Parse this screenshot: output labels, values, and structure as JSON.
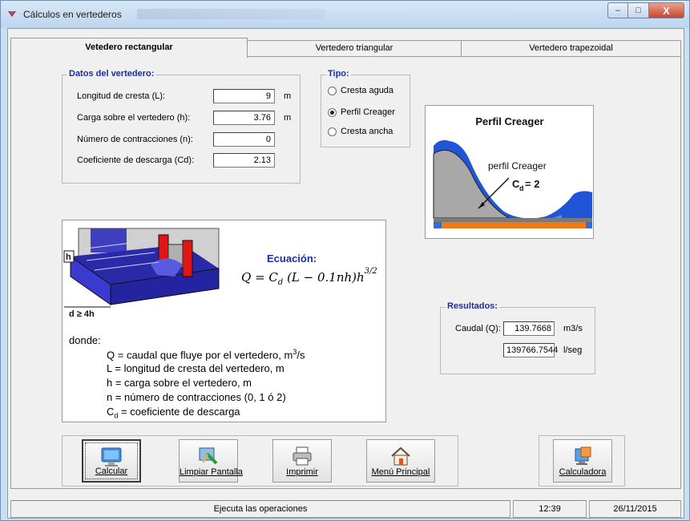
{
  "window": {
    "title": "Cálculos en vertederos",
    "title_blurred": "",
    "controls": {
      "minimize": "–",
      "maximize": "□",
      "close": "X"
    }
  },
  "tabs": [
    {
      "label": "Vetedero rectangular",
      "active": true
    },
    {
      "label": "Vertedero triangular",
      "active": false
    },
    {
      "label": "Vertedero trapezoidal",
      "active": false
    }
  ],
  "datos": {
    "legend": "Datos del vertedero:",
    "fields": [
      {
        "label": "Longitud de cresta (L):",
        "value": "9",
        "unit": "m"
      },
      {
        "label": "Carga sobre el vertedero (h):",
        "value": "3.76",
        "unit": "m"
      },
      {
        "label": "Número de contracciones (n):",
        "value": "0",
        "unit": ""
      },
      {
        "label": "Coeficiente de descarga (Cd):",
        "value": "2.13",
        "unit": ""
      }
    ]
  },
  "tipo": {
    "legend": "Tipo:",
    "options": [
      {
        "label": "Cresta aguda",
        "selected": false
      },
      {
        "label": "Perfil Creager",
        "selected": true
      },
      {
        "label": "Cresta ancha",
        "selected": false
      }
    ]
  },
  "perfil": {
    "title": "Perfil Creager",
    "caption": "perfil Creager",
    "cd_label": "C",
    "cd_sub": "d",
    "cd_value": "= 2"
  },
  "diagram": {
    "label_h": "h",
    "label_d": "d ≥ 4h",
    "equation_title": "Ecuación:",
    "donde": "donde:",
    "legend": [
      {
        "sym": "Q",
        "sub": "",
        "text": " = caudal que fluye por el vertedero, m",
        "sup": "3",
        "tail": "/s"
      },
      {
        "sym": "L",
        "sub": "",
        "text": " = longitud de cresta del vertedero, m",
        "sup": "",
        "tail": ""
      },
      {
        "sym": "h",
        "sub": "",
        "text": " = carga sobre el vertedero, m",
        "sup": "",
        "tail": ""
      },
      {
        "sym": "n",
        "sub": "",
        "text": " = número de contracciones (0, 1 ó 2)",
        "sup": "",
        "tail": ""
      },
      {
        "sym": "C",
        "sub": "d",
        "text": " = coeficiente de descarga",
        "sup": "",
        "tail": ""
      }
    ]
  },
  "resultados": {
    "legend": "Resultados:",
    "caudal_label": "Caudal (Q):",
    "caudal_m3s": "139.7668",
    "unit_m3s": "m3/s",
    "caudal_ls": "139766.7544",
    "unit_ls": "l/seg"
  },
  "buttons": {
    "calcular": "Calcular",
    "limpiar": "Limpiar Pantalla",
    "imprimir": "Imprimir",
    "menu": "Menú Principal",
    "calculadora": "Calculadora"
  },
  "status": {
    "message": "Ejecuta las operaciones",
    "time": "12:39",
    "date": "26/11/2015"
  },
  "colors": {
    "legend_blue": "#1a2fa0",
    "water_blue": "#1f55d6",
    "weir_gray": "#a8a8a8",
    "base_orange": "#f07a18"
  }
}
